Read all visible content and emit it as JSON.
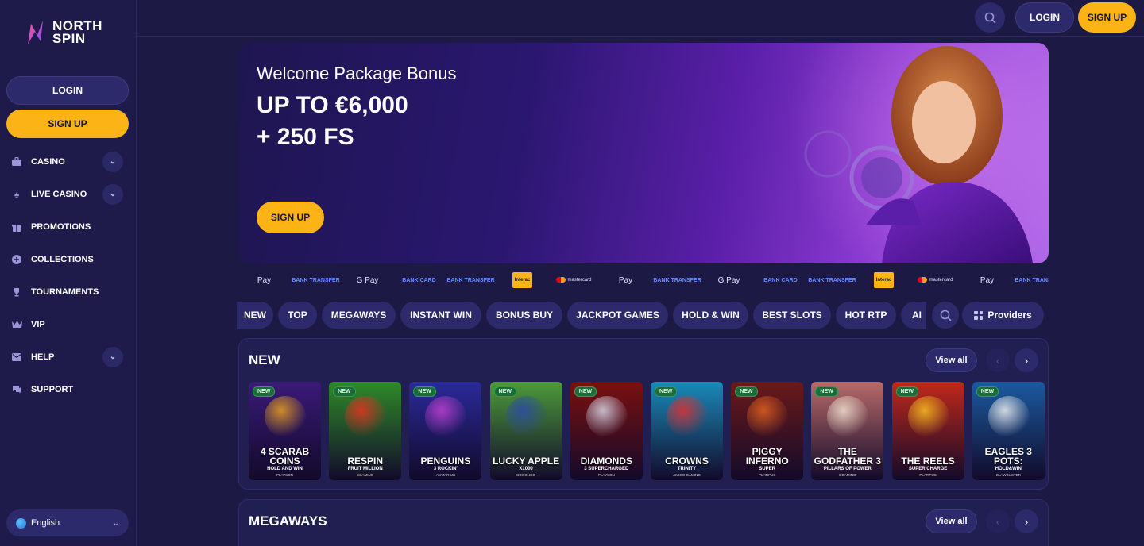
{
  "brand": {
    "line1": "NORTH",
    "line2": "SPIN"
  },
  "sidebar": {
    "login_label": "LOGIN",
    "signup_label": "SIGN UP",
    "items": [
      {
        "label": "CASINO",
        "icon": "briefcase-icon",
        "has_chevron": true
      },
      {
        "label": "LIVE CASINO",
        "icon": "spade-icon",
        "has_chevron": true
      },
      {
        "label": "PROMOTIONS",
        "icon": "gift-icon",
        "has_chevron": false
      },
      {
        "label": "COLLECTIONS",
        "icon": "plus-circle-icon",
        "has_chevron": false
      },
      {
        "label": "TOURNAMENTS",
        "icon": "trophy-icon",
        "has_chevron": false
      },
      {
        "label": "VIP",
        "icon": "crown-icon",
        "has_chevron": false
      },
      {
        "label": "HELP",
        "icon": "mail-icon",
        "has_chevron": true
      },
      {
        "label": "SUPPORT",
        "icon": "chat-icon",
        "has_chevron": false
      }
    ],
    "language": "English"
  },
  "header": {
    "login_label": "LOGIN",
    "signup_label": "SIGN UP"
  },
  "hero": {
    "subtitle": "Welcome Package Bonus",
    "title_line1": "UP TO €6,000",
    "title_line2": "+ 250 FS",
    "cta": "SIGN UP"
  },
  "payments": [
    {
      "label": "Pay",
      "type": "applepay"
    },
    {
      "label": "BANK TRANSFER",
      "type": "bank"
    },
    {
      "label": "G Pay",
      "type": "gpay"
    },
    {
      "label": "BANK CARD",
      "type": "bank"
    },
    {
      "label": "BANK TRANSFER",
      "type": "bank"
    },
    {
      "label": "Interac",
      "type": "interac"
    },
    {
      "label": "mastercard",
      "type": "mc"
    },
    {
      "label": "Pay",
      "type": "applepay"
    },
    {
      "label": "BANK TRANSFER",
      "type": "bank"
    },
    {
      "label": "G Pay",
      "type": "gpay"
    },
    {
      "label": "BANK CARD",
      "type": "bank"
    },
    {
      "label": "BANK TRANSFER",
      "type": "bank"
    },
    {
      "label": "Interac",
      "type": "interac"
    },
    {
      "label": "mastercard",
      "type": "mc"
    },
    {
      "label": "Pay",
      "type": "applepay"
    },
    {
      "label": "BANK TRANSFER",
      "type": "bank"
    }
  ],
  "categories": [
    "NEW",
    "TOP",
    "MEGAWAYS",
    "INSTANT WIN",
    "BONUS BUY",
    "JACKPOT GAMES",
    "HOLD & WIN",
    "BEST SLOTS",
    "HOT RTP",
    "AI"
  ],
  "providers_label": "Providers",
  "sections": [
    {
      "title": "NEW",
      "view_all": "View all",
      "games": [
        {
          "badge": "NEW",
          "name": "4 SCARAB COINS",
          "sub": "HOLD AND WIN",
          "provider": "PLAYSON",
          "bg": "#3a1a78",
          "accent": "#e8a020"
        },
        {
          "badge": "NEW",
          "name": "RESPIN",
          "sub": "FRUIT MILLION",
          "provider": "BGAMING",
          "bg": "#2f8a2a",
          "accent": "#e83020"
        },
        {
          "badge": "NEW",
          "name": "PENGUINS",
          "sub": "3 ROCKIN'",
          "provider": "AVATAR UX",
          "bg": "#2a2a9a",
          "accent": "#c040d0"
        },
        {
          "badge": "NEW",
          "name": "LUCKY APPLE",
          "sub": "X1000",
          "provider": "BOOONGO",
          "bg": "#4d9a3a",
          "accent": "#2a4aa8"
        },
        {
          "badge": "NEW",
          "name": "DIAMONDS",
          "sub": "3 SUPERCHARGED",
          "provider": "PLAYSON",
          "bg": "#7a1010",
          "accent": "#d8d8e8"
        },
        {
          "badge": "NEW",
          "name": "CROWNS",
          "sub": "TRINITY",
          "provider": "AMIGO GAMING",
          "bg": "#1a8ab8",
          "accent": "#e03030"
        },
        {
          "badge": "NEW",
          "name": "PIGGY INFERNO",
          "sub": "SUPER",
          "provider": "PLATIPUS",
          "bg": "#6a1a1a",
          "accent": "#e06020"
        },
        {
          "badge": "NEW",
          "name": "THE GODFATHER 3",
          "sub": "PILLARS OF POWER",
          "provider": "BGAMING",
          "bg": "#b86a6a",
          "accent": "#f0e0d0"
        },
        {
          "badge": "NEW",
          "name": "THE REELS",
          "sub": "SUPER CHARGE",
          "provider": "PLATIPUS",
          "bg": "#c0281a",
          "accent": "#f8c020"
        },
        {
          "badge": "NEW",
          "name": "EAGLES 3 POTS:",
          "sub": "HOLD&WIN",
          "provider": "CLAWBUSTER",
          "bg": "#1a5aa0",
          "accent": "#f0f0f0"
        }
      ]
    },
    {
      "title": "MEGAWAYS",
      "view_all": "View all"
    }
  ],
  "colors": {
    "accent": "#fbb315",
    "sidebar_bg": "#1e1b4b",
    "page_bg": "#1c1a45",
    "pill_bg": "#2c2a6a"
  }
}
